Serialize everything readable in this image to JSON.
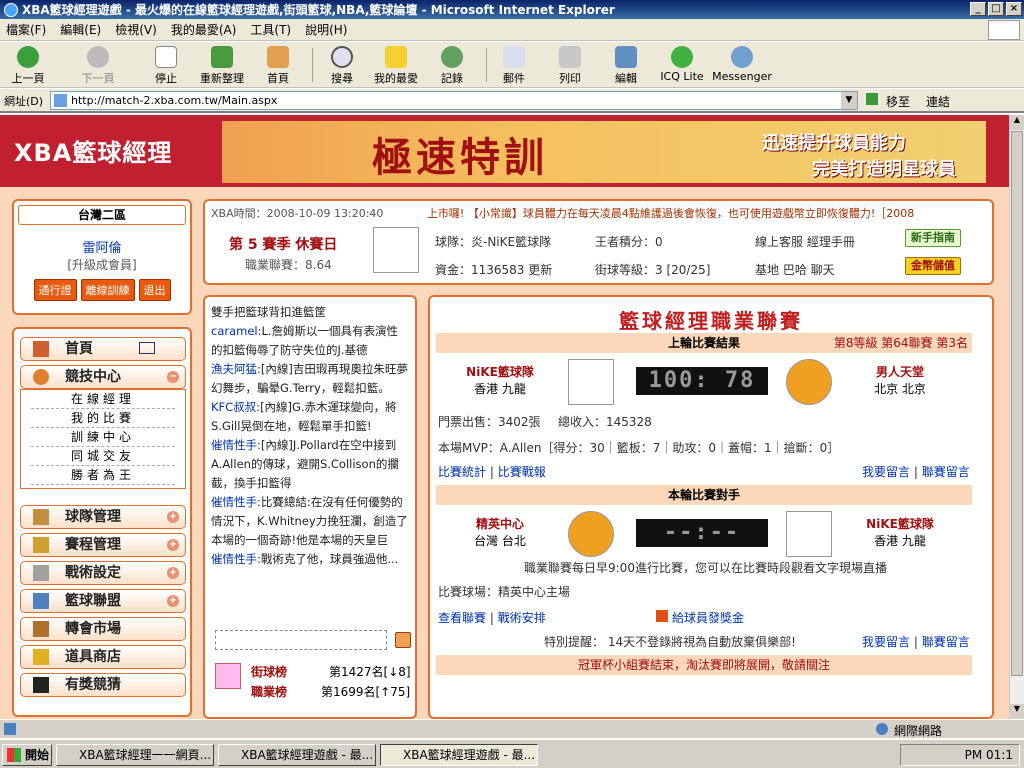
{
  "window": {
    "title": "XBA籃球經理遊戲 - 最火爆的在線籃球經理遊戲,街頭籃球,NBA,籃球論壇 - Microsoft Internet Explorer"
  },
  "menu": [
    "檔案(F)",
    "編輯(E)",
    "檢視(V)",
    "我的最愛(A)",
    "工具(T)",
    "說明(H)"
  ],
  "toolbar": {
    "back": "上一頁",
    "forward": "下一頁",
    "stop": "停止",
    "refresh": "重新整理",
    "home": "首頁",
    "search": "搜尋",
    "favorites": "我的最愛",
    "history": "記錄",
    "mail": "郵件",
    "print": "列印",
    "edit": "編輯",
    "icq": "ICQ Lite",
    "messenger": "Messenger"
  },
  "address": {
    "label": "網址(D)",
    "url": "http://match-2.xba.com.tw/Main.aspx",
    "go": "移至",
    "links": "連結"
  },
  "site": {
    "logo": "XBA籃球經理",
    "banner_title": "極速特訓",
    "banner_line1": "迅速提升球員能力",
    "banner_line2": "完美打造明星球員"
  },
  "user": {
    "region": "台灣二區",
    "name": "雷阿倫",
    "level": "[升級成會員]",
    "btn_pass": "通行證",
    "btn_offline": "離線訓練",
    "btn_exit": "退出"
  },
  "nav": {
    "home": "首頁",
    "arena": "競技中心",
    "sub": [
      "在線經理",
      "我的比賽",
      "訓練中心",
      "同城交友",
      "勝者為王"
    ],
    "team": "球隊管理",
    "schedule": "賽程管理",
    "tactics": "戰術設定",
    "alliance": "籃球聯盟",
    "transfer": "轉會市場",
    "shop": "道具商店",
    "guess": "有獎競猜"
  },
  "info": {
    "time": "XBA時間：2008-10-09 13:20:40",
    "ticker_a": "上市囉!",
    "ticker_b": "【小常識】球員體力在每天凌晨4點維護過後會恢復，也可使用遊戲幣立即恢復體力!［2008",
    "season": "第 5 賽季  休賽日",
    "league_points": "職業聯賽：8.64",
    "team": "球隊：炎-NiKE籃球隊",
    "money": "資金：1136583 更新",
    "king_points": "王者積分：0",
    "team_level": "街球等級：3 [20/25]",
    "support": "線上客服  經理手冊",
    "base": "基地  巴哈  聊天",
    "guide_btn": "新手指南",
    "pay_btn": "金幣儲值"
  },
  "chat": {
    "messages": [
      {
        "user": "",
        "text": "雙手把籃球背扣進籃筐"
      },
      {
        "user": "caramel:",
        "text": "L.詹姆斯以一個具有表演性的扣籃侮辱了防守失位的J.基德"
      },
      {
        "user": "漁夫阿猛:",
        "text": "[內線]吉田瑕再現奧拉朱旺夢幻舞步，騙晕G.Terry，輕鬆扣籃。"
      },
      {
        "user": "KFC叔叔:",
        "text": "[內線]G.赤木運球變向，將S.Gill晃倒在地，輕鬆單手扣籃!"
      },
      {
        "user": "催情性手:",
        "text": "[內線]J.Pollard在空中接到A.Allen的傳球，避開S.Collison的攔截，換手扣籃得"
      },
      {
        "user": "催情性手:",
        "text": "比賽總結:在沒有任何優勢的情況下，K.Whitney力挽狂瀾，創造了本場的一個奇跡!他是本場的天皇巨"
      },
      {
        "user": "催情性手:",
        "text": "戰術克了他，球員強過他..."
      }
    ],
    "street_rank_label": "街球榜",
    "street_rank": "第1427名[↓8]",
    "league_rank_label": "職業榜",
    "league_rank": "第1699名[↑75]"
  },
  "league": {
    "title": "籃球經理職業聯賽",
    "last_result": "上輪比賽結果",
    "last_meta": "第8等級  第64聯賽  第3名",
    "home_team": "NiKE籃球隊",
    "home_city": "香港  九龍",
    "score": "100: 78",
    "away_team": "男人天堂",
    "away_city": "北京  北京",
    "tickets": "門票出售：3402張",
    "income": "總收入：145328",
    "mvp": "本場MVP：A.Allen［得分：30｜籃板：7｜助攻：0｜蓋帽：1｜搶斷：0］",
    "stats_link": "比賽統計",
    "report_link": "比賽戰報",
    "msg_link": "我要留言",
    "league_msg_link": "聯賽留言",
    "next_opponent": "本輪比賽對手",
    "next_home": "精英中心",
    "next_home_city": "台灣  台北",
    "next_score": "--:--",
    "next_away": "NiKE籃球隊",
    "next_away_city": "香港  九龍",
    "note": "職業聯賽每日早9:00進行比賽，您可以在比賽時段觀看文字現場直播",
    "venue": "比賽球場：精英中心主場",
    "view_league": "查看聯賽",
    "tactics_link": "戰術安排",
    "bonus_link": "給球員發獎金",
    "warning": "特別提醒：  14天不登錄將視為自動放棄俱樂部!",
    "msg_link2": "我要留言",
    "league_msg_link2": "聯賽留言",
    "cup_note": "冠軍杯小組賽結束，淘汰賽即將展開，敬請關注"
  },
  "status": {
    "zone": "網際網路"
  },
  "taskbar": {
    "start": "開始",
    "item1": "XBA籃球經理一一網頁...",
    "item2": "XBA籃球經理遊戲 - 最...",
    "item3": "XBA籃球經理遊戲 - 最...",
    "clock": "PM 01:1"
  }
}
